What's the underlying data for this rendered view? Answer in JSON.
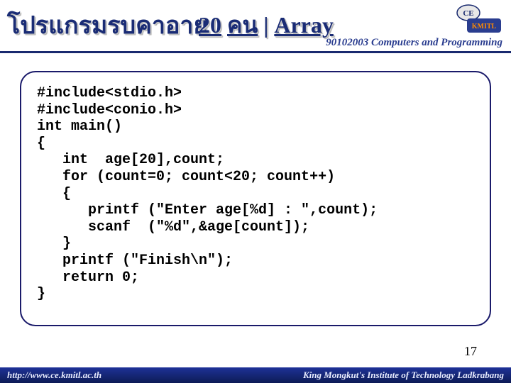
{
  "header": {
    "title_left": "โปรแกรมรบคาอาย",
    "title_right_num": "20",
    "title_right_word": "คน",
    "title_right_sep": " | ",
    "title_right_arr": "Array",
    "course": "90102003 Computers and Programming"
  },
  "logo": {
    "top_text": "CE",
    "bottom_text": "KMITL"
  },
  "code": {
    "text": "#include<stdio.h>\n#include<conio.h>\nint main()\n{\n   int  age[20],count;\n   for (count=0; count<20; count++)\n   {\n      printf (\"Enter age[%d] : \",count);\n      scanf  (\"%d\",&age[count]);\n   }\n   printf (\"Finish\\n\");\n   return 0;\n}"
  },
  "page_number": "17",
  "footer": {
    "left": "http://www.ce.kmitl.ac.th",
    "right": "King Mongkut's Institute of Technology Ladkrabang"
  }
}
